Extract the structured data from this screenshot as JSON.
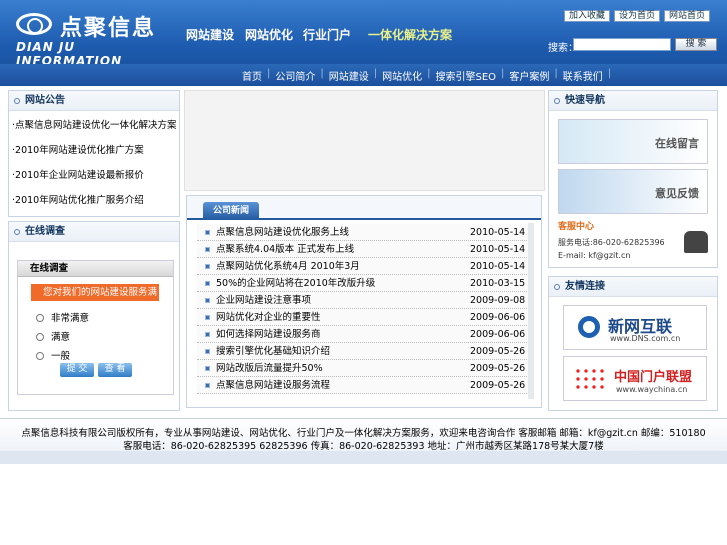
{
  "header": {
    "logo_cn": "点聚信息",
    "logo_en": "DIAN JU INFORMATION",
    "nav": [
      "网站建设",
      "网站优化",
      "行业门户"
    ],
    "solution": "一体化解决方案",
    "toplinks": [
      "加入收藏",
      "设为首页",
      "网站首页"
    ],
    "search_label": "搜索：",
    "search_btn": "搜 索"
  },
  "navbar": [
    "首页",
    "公司简介",
    "网站建设",
    "网站优化",
    "搜索引擎SEO",
    "客户案例",
    "联系我们"
  ],
  "notice": {
    "title": "网站公告",
    "items": [
      "·点聚信息网站建设优化一体化解决方案",
      "·2010年网站建设优化推广方案",
      "·2010年企业网站建设最新报价",
      "·2010年网站优化推广服务介绍"
    ]
  },
  "survey": {
    "title": "在线调查",
    "head": "在线调查",
    "question": "您对我们的网站建设服务满意吗?",
    "options": [
      "非常满意",
      "满意",
      "一般"
    ],
    "submit": "提 交",
    "view": "查 看"
  },
  "news": {
    "tab": "公司新闻",
    "rows": [
      {
        "title": "点聚信息网站建设优化服务上线",
        "date": "2010-05-14"
      },
      {
        "title": "点聚系统4.04版本 正式发布上线",
        "date": "2010-05-14"
      },
      {
        "title": "点聚网站优化系统4月 2010年3月",
        "date": "2010-05-14"
      },
      {
        "title": "50%的企业网站将在2010年改版升级",
        "date": "2010-03-15"
      },
      {
        "title": "企业网站建设注意事项",
        "date": "2009-09-08"
      },
      {
        "title": "网站优化对企业的重要性",
        "date": "2009-06-06"
      },
      {
        "title": "如何选择网站建设服务商",
        "date": "2009-06-06"
      },
      {
        "title": "搜索引擎优化基础知识介绍",
        "date": "2009-05-26"
      },
      {
        "title": "网站改版后流量提升50%",
        "date": "2009-05-26"
      },
      {
        "title": "点聚信息网站建设服务流程",
        "date": "2009-05-26"
      }
    ]
  },
  "quick": {
    "title": "快速导航",
    "msg": "在线留言",
    "feedback": "意见反馈",
    "svc_title": "客服中心",
    "svc_phone": "服务电话:86-020-62825396",
    "svc_mail": "E-mail: kf@gzit.cn"
  },
  "links": {
    "title": "友情连接",
    "link1": "新网互联",
    "link1_sub": "www.DNS.com.cn",
    "link2": "中国门户联盟",
    "link2_sub": "www.waychina.cn"
  },
  "footer": {
    "line1": "点聚信息科技有限公司版权所有，专业从事网站建设、网站优化、行业门户及一体化解决方案服务，欢迎来电咨询合作  客服邮箱  邮箱：kf@gzit.cn    邮编：510180",
    "line2": "客服电话：86-020-62825395 62825396      传真：86-020-62825393  地址：广州市越秀区某路178号某大厦7楼"
  },
  "colors": {
    "header": "#1e5cb0",
    "accent": "#f06a2a"
  }
}
